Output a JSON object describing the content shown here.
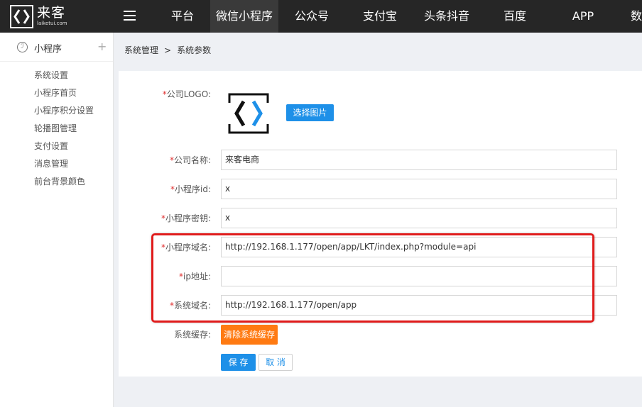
{
  "brand": {
    "name_cn": "来客",
    "name_en": "laiketui.com"
  },
  "topnav": {
    "items": [
      {
        "label": "平台",
        "active": false
      },
      {
        "label": "微信小程序",
        "active": true
      },
      {
        "label": "公众号",
        "active": false
      },
      {
        "label": "支付宝",
        "active": false
      },
      {
        "label": "头条抖音",
        "active": false
      },
      {
        "label": "百度",
        "active": false
      },
      {
        "label": "APP",
        "active": false
      },
      {
        "label": "数",
        "active": false
      }
    ]
  },
  "sidebar": {
    "title": "小程序",
    "items": [
      {
        "label": "系统设置"
      },
      {
        "label": "小程序首页"
      },
      {
        "label": "小程序积分设置"
      },
      {
        "label": "轮播图管理"
      },
      {
        "label": "支付设置"
      },
      {
        "label": "消息管理"
      },
      {
        "label": "前台背景颜色"
      }
    ]
  },
  "breadcrumb": {
    "parent": "系统管理",
    "separator": ">",
    "current": "系统参数"
  },
  "form": {
    "logo_label": "公司LOGO:",
    "choose_image_label": "选择图片",
    "company_name": {
      "label": "公司名称:",
      "value": "来客电商"
    },
    "appid": {
      "label": "小程序id:",
      "value": "x"
    },
    "app_secret": {
      "label": "小程序密钥:",
      "value": "x"
    },
    "domain": {
      "label": "小程序域名:",
      "value": "http://192.168.1.177/open/app/LKT/index.php?module=api"
    },
    "ip": {
      "label": "ip地址:",
      "value": ""
    },
    "system_domain": {
      "label": "系统域名:",
      "value": "http://192.168.1.177/open/app"
    },
    "cache_label": "系统缓存:",
    "clear_cache_label": "清除系统缓存",
    "save_label": "保 存",
    "cancel_label": "取 消",
    "required_mark": "*"
  },
  "colors": {
    "primary": "#1e90e8",
    "warning": "#ff7a12",
    "highlight": "#e01b1b",
    "topbar": "#262626"
  }
}
